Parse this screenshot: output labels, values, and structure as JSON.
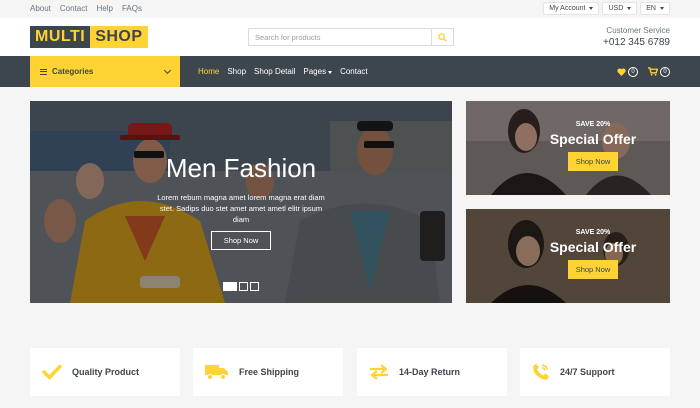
{
  "topbar": {
    "links": [
      "About",
      "Contact",
      "Help",
      "FAQs"
    ],
    "account": "My Account",
    "currency": "USD",
    "language": "EN"
  },
  "header": {
    "logo_part1": "MULTI",
    "logo_part2": "SHOP",
    "search_placeholder": "Search for products",
    "service_label": "Customer Service",
    "service_phone": "+012 345 6789"
  },
  "navbar": {
    "categories_label": "Categories",
    "menu": [
      "Home",
      "Shop",
      "Shop Detail",
      "Pages",
      "Contact"
    ],
    "wishlist_count": "0",
    "cart_count": "0"
  },
  "hero": {
    "title": "Men Fashion",
    "description": "Lorem rebum magna amet lorem magna erat diam stet. Sadips duo stet amet amet ametl elitr ipsum diam",
    "button": "Shop Now",
    "slides": 3,
    "active_slide": 1
  },
  "offers": [
    {
      "save": "SAVE 20%",
      "title": "Special Offer",
      "button": "Shop Now"
    },
    {
      "save": "SAVE 20%",
      "title": "Special Offer",
      "button": "Shop Now"
    }
  ],
  "features": [
    {
      "label": "Quality Product",
      "icon": "check-icon"
    },
    {
      "label": "Free Shipping",
      "icon": "truck-icon"
    },
    {
      "label": "14-Day Return",
      "icon": "exchange-icon"
    },
    {
      "label": "24/7 Support",
      "icon": "phone-icon"
    }
  ],
  "colors": {
    "accent": "#ffd333",
    "dark": "#3d464d",
    "background": "#f5f5f5"
  }
}
